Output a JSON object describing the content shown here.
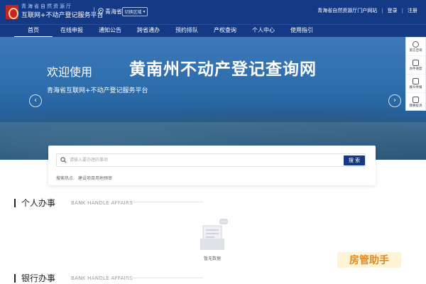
{
  "header": {
    "logo_line1": "青海省自然资源厅",
    "logo_line2": "互联网+不动产登记服务平台",
    "region": "青海省",
    "switch_label": "切换区域",
    "links": [
      "青海省自然资源厅门户网站",
      "登录",
      "注册"
    ]
  },
  "nav": {
    "items": [
      "首页",
      "在线申报",
      "通知公告",
      "跨省通办",
      "预约排队",
      "产权查询",
      "个人中心",
      "使用指引"
    ]
  },
  "hero": {
    "welcome": "欢迎使用",
    "title": "黄南州不动产登记查询网",
    "subtitle": "青海省互联网+不动产登记服务平台"
  },
  "float_panel": {
    "items": [
      "留言咨询",
      "办件进度",
      "群众举报",
      "我要投诉"
    ]
  },
  "search": {
    "placeholder": "请输入要办理的事项",
    "button": "搜 索",
    "hot_label": "搜索热点:",
    "hot_items": [
      "建设项目用地预审"
    ]
  },
  "sections": [
    {
      "title": "个人办事",
      "en": "BANK HANDLE AFFAIRS"
    },
    {
      "title": "银行办事",
      "en": "BANK HANDLE AFFAIRS"
    }
  ],
  "empty_state": {
    "label": "暂无数据"
  },
  "watermark": {
    "text": "房管助手"
  },
  "colors": {
    "primary": "#143a86",
    "hero": "#2f6fad"
  }
}
